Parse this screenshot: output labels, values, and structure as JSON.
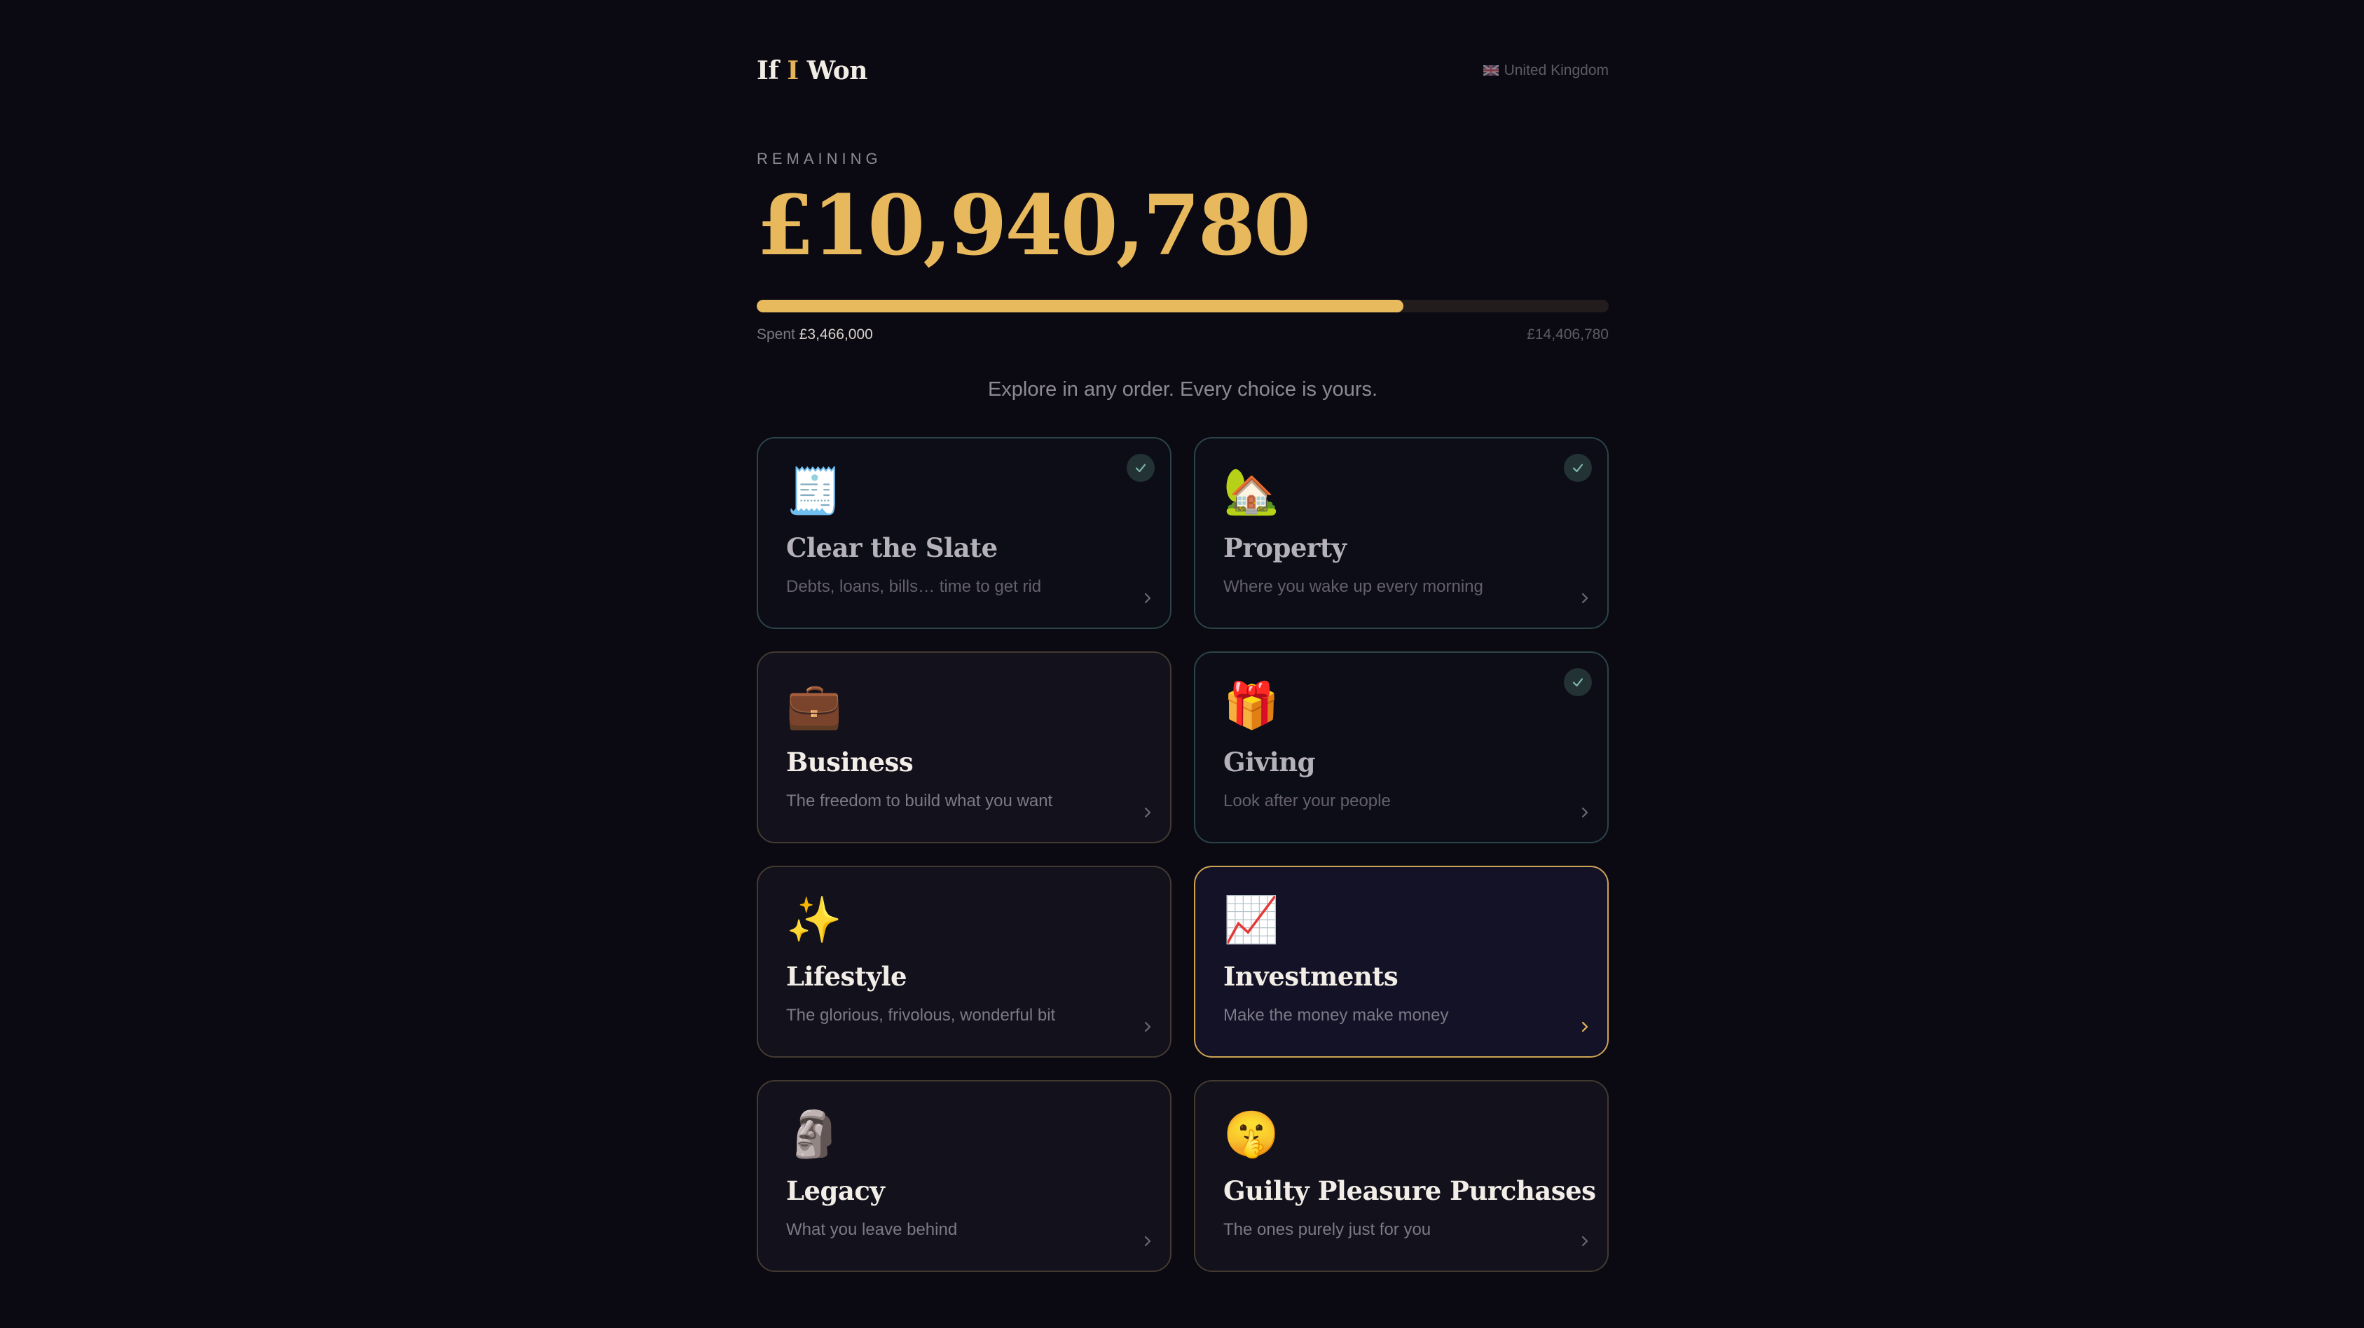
{
  "header": {
    "logo_part1": "If ",
    "logo_accent": "I",
    "logo_part2": " Won",
    "region": "United Kingdom",
    "region_icon": "uk-flag-icon"
  },
  "summary": {
    "remaining_label": "REMAINING",
    "remaining_amount": "£10,940,780",
    "spent_label": "Spent",
    "spent_amount": "£3,466,000",
    "total_amount": "£14,406,780",
    "spent_fraction": 0.7594,
    "subtitle": "Explore in any order. Every choice is yours."
  },
  "colors": {
    "accent": "#e8b85c",
    "background": "#0b0a12",
    "card_done_border": "#2b4448",
    "card_active_border": "#cfa455"
  },
  "categories": [
    {
      "title": "Clear the Slate",
      "description": "Debts, loans, bills… time to get rid",
      "icon": "receipt-icon",
      "emoji": "🧾",
      "completed": true,
      "selected": false
    },
    {
      "title": "Property",
      "description": "Where you wake up every morning",
      "icon": "house-with-garden-icon",
      "emoji": "🏡",
      "completed": true,
      "selected": false
    },
    {
      "title": "Business",
      "description": "The freedom to build what you want",
      "icon": "briefcase-icon",
      "emoji": "💼",
      "completed": false,
      "selected": false
    },
    {
      "title": "Giving",
      "description": "Look after your people",
      "icon": "gift-icon",
      "emoji": "🎁",
      "completed": true,
      "selected": false
    },
    {
      "title": "Lifestyle",
      "description": "The glorious, frivolous, wonderful bit",
      "icon": "sparkles-icon",
      "emoji": "✨",
      "completed": false,
      "selected": false
    },
    {
      "title": "Investments",
      "description": "Make the money make money",
      "icon": "chart-increasing-icon",
      "emoji": "📈",
      "completed": false,
      "selected": true
    },
    {
      "title": "Legacy",
      "description": "What you leave behind",
      "icon": "moai-icon",
      "emoji": "🗿",
      "completed": false,
      "selected": false
    },
    {
      "title": "Guilty Pleasure Purchases",
      "description": "The ones purely just for you",
      "icon": "shushing-face-icon",
      "emoji": "🤫",
      "completed": false,
      "selected": false
    }
  ]
}
